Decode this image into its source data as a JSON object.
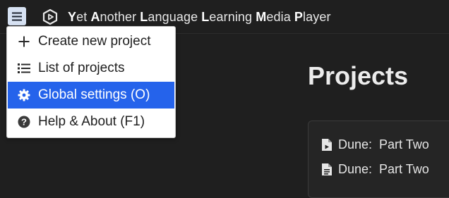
{
  "header": {
    "menu_icon": "hamburger-icon",
    "logo_icon": "hexagon-play-icon",
    "title_parts": [
      {
        "initial": "Y",
        "rest": "et "
      },
      {
        "initial": "A",
        "rest": "nother "
      },
      {
        "initial": "L",
        "rest": "anguage "
      },
      {
        "initial": "L",
        "rest": "earning "
      },
      {
        "initial": "M",
        "rest": "edia "
      },
      {
        "initial": "P",
        "rest": "layer"
      }
    ]
  },
  "menu": {
    "items": [
      {
        "label": "Create new project",
        "icon": "plus-icon"
      },
      {
        "label": "List of projects",
        "icon": "list-icon"
      },
      {
        "label": "Global settings (O)",
        "icon": "gear-icon",
        "selected": true
      },
      {
        "label": "Help & About (F1)",
        "icon": "help-icon"
      }
    ]
  },
  "main": {
    "title": "Projects",
    "projects": [
      {
        "name": "Dune:  Part Two",
        "icon": "file-video-icon"
      },
      {
        "name": "Dune:  Part Two",
        "icon": "file-text-icon"
      }
    ]
  },
  "colors": {
    "background": "#1f1f1f",
    "accent": "#2563eb",
    "menu_button_bg": "#d7e2f3"
  }
}
